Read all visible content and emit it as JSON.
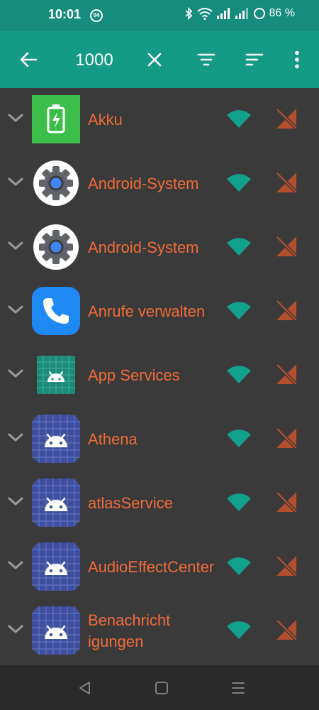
{
  "status": {
    "time": "10:01",
    "badge": "94",
    "battery": "86 %"
  },
  "toolbar": {
    "search_value": "1000"
  },
  "apps": [
    {
      "name": "Akku",
      "icon": "battery-app-icon"
    },
    {
      "name": "Android-System",
      "icon": "gear-app-icon"
    },
    {
      "name": "Android-System",
      "icon": "gear-app-icon"
    },
    {
      "name": "Anrufe verwalten",
      "icon": "phone-app-icon"
    },
    {
      "name": "App Services",
      "icon": "android-app-icon"
    },
    {
      "name": "Athena",
      "icon": "android-app-icon"
    },
    {
      "name": "atlasService",
      "icon": "android-app-icon"
    },
    {
      "name": "AudioEffectCenter",
      "icon": "android-app-icon"
    },
    {
      "name": "Benachrichtigungen",
      "icon": "android-app-icon"
    }
  ],
  "colors": {
    "accent": "#159a86",
    "statusbar": "#168c7c",
    "label": "#f06a3b",
    "wifi": "#12a08a",
    "cell": "#b5502e",
    "background": "#3a3a3a"
  }
}
